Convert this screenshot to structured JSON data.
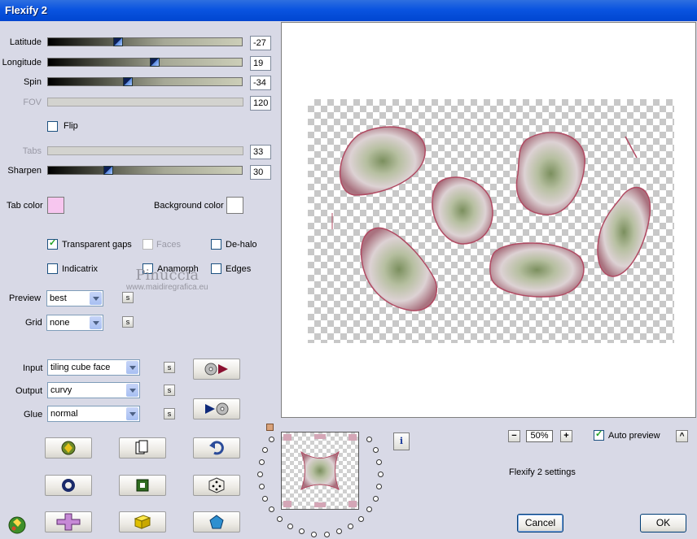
{
  "window": {
    "title": "Flexify 2"
  },
  "sliders": [
    {
      "label": "Latitude",
      "value": "-27",
      "fraction": 0.36,
      "enabled": true
    },
    {
      "label": "Longitude",
      "value": "19",
      "fraction": 0.55,
      "enabled": true
    },
    {
      "label": "Spin",
      "value": "-34",
      "fraction": 0.41,
      "enabled": true
    },
    {
      "label": "FOV",
      "value": "120",
      "fraction": null,
      "enabled": false
    },
    {
      "label": "Tabs",
      "value": "33",
      "fraction": null,
      "enabled": false
    },
    {
      "label": "Sharpen",
      "value": "30",
      "fraction": 0.31,
      "enabled": true
    }
  ],
  "flip": {
    "label": "Flip",
    "checked": false
  },
  "colors": {
    "tab_label": "Tab color",
    "tab_value": "#f7c6ef",
    "bg_label": "Background color",
    "bg_value": "#ffffff"
  },
  "options": {
    "transparent_gaps": {
      "label": "Transparent gaps",
      "checked": true
    },
    "faces": {
      "label": "Faces",
      "checked": false
    },
    "de_halo": {
      "label": "De-halo",
      "checked": false
    },
    "indicatrix": {
      "label": "Indicatrix",
      "checked": false
    },
    "anamorph": {
      "label": "Anamorph",
      "checked": false
    },
    "edges": {
      "label": "Edges",
      "checked": false
    }
  },
  "dropdowns": {
    "preview": {
      "label": "Preview",
      "value": "best"
    },
    "grid": {
      "label": "Grid",
      "value": "none"
    },
    "input": {
      "label": "Input",
      "value": "tiling cube face"
    },
    "output": {
      "label": "Output",
      "value": "curvy"
    },
    "glue": {
      "label": "Glue",
      "value": "normal"
    }
  },
  "lock_glyph": "s",
  "watermark": {
    "line1": "Pinuccia",
    "line2": "www.maidiregrafica.eu"
  },
  "zoom": {
    "minus": "−",
    "value": "50%",
    "plus": "+"
  },
  "auto_preview": {
    "label": "Auto preview",
    "checked": true,
    "arrow": "^"
  },
  "settings_label": "Flexify 2 settings",
  "info_glyph": "i",
  "buttons": {
    "cancel": "Cancel",
    "ok": "OK"
  },
  "icons": [
    "randomize-icon",
    "copy-icon",
    "undo-icon",
    "ring-icon",
    "frame-icon",
    "dice-icon",
    "cross-icon",
    "cube-icon",
    "pentagon-icon"
  ],
  "theme": {
    "accent_blue": "#0a54e0",
    "shape_rose": "#b98a9a",
    "shape_green": "#8a9f7a"
  }
}
